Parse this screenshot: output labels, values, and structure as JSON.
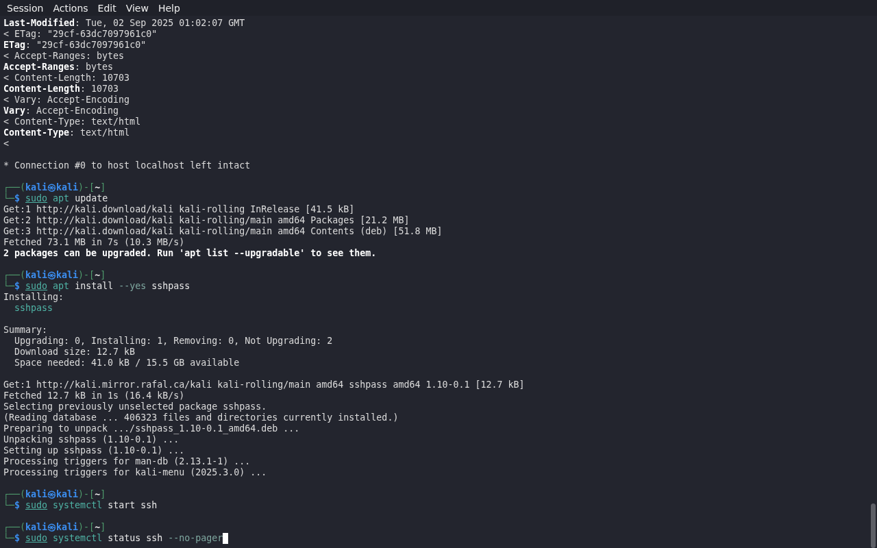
{
  "menu": [
    "Session",
    "Actions",
    "Edit",
    "View",
    "Help"
  ],
  "lines": [
    {
      "kind": "text",
      "text": "**Last-Modified**: Tue, 02 Sep 2025 01:02:07 GMT"
    },
    {
      "kind": "text",
      "text": "< ETag: \"29cf-63dc7097961c0\""
    },
    {
      "kind": "text",
      "text": "**ETag**: \"29cf-63dc7097961c0\""
    },
    {
      "kind": "text",
      "text": "< Accept-Ranges: bytes"
    },
    {
      "kind": "text",
      "text": "**Accept-Ranges**: bytes"
    },
    {
      "kind": "text",
      "text": "< Content-Length: 10703"
    },
    {
      "kind": "text",
      "text": "**Content-Length**: 10703"
    },
    {
      "kind": "text",
      "text": "< Vary: Accept-Encoding"
    },
    {
      "kind": "text",
      "text": "**Vary**: Accept-Encoding"
    },
    {
      "kind": "text",
      "text": "< Content-Type: text/html"
    },
    {
      "kind": "text",
      "text": "**Content-Type**: text/html"
    },
    {
      "kind": "text",
      "text": "<"
    },
    {
      "kind": "blank"
    },
    {
      "kind": "text",
      "text": "* Connection #0 to host localhost left intact"
    },
    {
      "kind": "blank"
    },
    {
      "kind": "prompt",
      "open": "┌──(",
      "user": "kali",
      "at": "㉿",
      "host": "kali",
      "mid": ")-[",
      "dir": "~",
      "close": "]",
      "corner": "└─",
      "sign": "$",
      "cursor": false,
      "command": [
        {
          "kind": "sudo",
          "text": "sudo"
        },
        {
          "kind": "program",
          "text": "apt"
        },
        {
          "kind": "arg",
          "text": "update"
        }
      ]
    },
    {
      "kind": "text",
      "text": "Get:1 http://kali.download/kali kali-rolling InRelease [41.5 kB]"
    },
    {
      "kind": "text",
      "text": "Get:2 http://kali.download/kali kali-rolling/main amd64 Packages [21.2 MB]"
    },
    {
      "kind": "text",
      "text": "Get:3 http://kali.download/kali kali-rolling/main amd64 Contents (deb) [51.8 MB]"
    },
    {
      "kind": "text",
      "text": "Fetched 73.1 MB in 7s (10.3 MB/s)"
    },
    {
      "kind": "bold",
      "text": "2 packages can be upgraded. Run 'apt list --upgradable' to see them."
    },
    {
      "kind": "blank"
    },
    {
      "kind": "prompt",
      "open": "┌──(",
      "user": "kali",
      "at": "㉿",
      "host": "kali",
      "mid": ")-[",
      "dir": "~",
      "close": "]",
      "corner": "└─",
      "sign": "$",
      "cursor": false,
      "command": [
        {
          "kind": "sudo",
          "text": "sudo"
        },
        {
          "kind": "program",
          "text": "apt"
        },
        {
          "kind": "arg",
          "text": "install"
        },
        {
          "kind": "option",
          "text": "--yes"
        },
        {
          "kind": "arg",
          "text": "sshpass"
        }
      ]
    },
    {
      "kind": "text",
      "text": "Installing:"
    },
    {
      "kind": "package",
      "text": "  sshpass"
    },
    {
      "kind": "blank"
    },
    {
      "kind": "text",
      "text": "Summary:"
    },
    {
      "kind": "text",
      "text": "  Upgrading: 0, Installing: 1, Removing: 0, Not Upgrading: 2"
    },
    {
      "kind": "text",
      "text": "  Download size: 12.7 kB"
    },
    {
      "kind": "text",
      "text": "  Space needed: 41.0 kB / 15.5 GB available"
    },
    {
      "kind": "blank"
    },
    {
      "kind": "text",
      "text": "Get:1 http://kali.mirror.rafal.ca/kali kali-rolling/main amd64 sshpass amd64 1.10-0.1 [12.7 kB]"
    },
    {
      "kind": "text",
      "text": "Fetched 12.7 kB in 1s (16.4 kB/s)"
    },
    {
      "kind": "text",
      "text": "Selecting previously unselected package sshpass."
    },
    {
      "kind": "text",
      "text": "(Reading database ... 406323 files and directories currently installed.)"
    },
    {
      "kind": "text",
      "text": "Preparing to unpack .../sshpass_1.10-0.1_amd64.deb ..."
    },
    {
      "kind": "text",
      "text": "Unpacking sshpass (1.10-0.1) ..."
    },
    {
      "kind": "text",
      "text": "Setting up sshpass (1.10-0.1) ..."
    },
    {
      "kind": "text",
      "text": "Processing triggers for man-db (2.13.1-1) ..."
    },
    {
      "kind": "text",
      "text": "Processing triggers for kali-menu (2025.3.0) ..."
    },
    {
      "kind": "blank"
    },
    {
      "kind": "prompt",
      "open": "┌──(",
      "user": "kali",
      "at": "㉿",
      "host": "kali",
      "mid": ")-[",
      "dir": "~",
      "close": "]",
      "corner": "└─",
      "sign": "$",
      "cursor": false,
      "command": [
        {
          "kind": "sudo",
          "text": "sudo"
        },
        {
          "kind": "program",
          "text": "systemctl"
        },
        {
          "kind": "arg",
          "text": "start"
        },
        {
          "kind": "arg",
          "text": "ssh"
        }
      ]
    },
    {
      "kind": "blank"
    },
    {
      "kind": "prompt",
      "open": "┌──(",
      "user": "kali",
      "at": "㉿",
      "host": "kali",
      "mid": ")-[",
      "dir": "~",
      "close": "]",
      "corner": "└─",
      "sign": "$",
      "cursor": true,
      "command": [
        {
          "kind": "sudo",
          "text": "sudo"
        },
        {
          "kind": "program",
          "text": "systemctl"
        },
        {
          "kind": "arg",
          "text": "status"
        },
        {
          "kind": "arg",
          "text": "ssh"
        },
        {
          "kind": "option",
          "text": "--no-pager"
        }
      ]
    }
  ]
}
